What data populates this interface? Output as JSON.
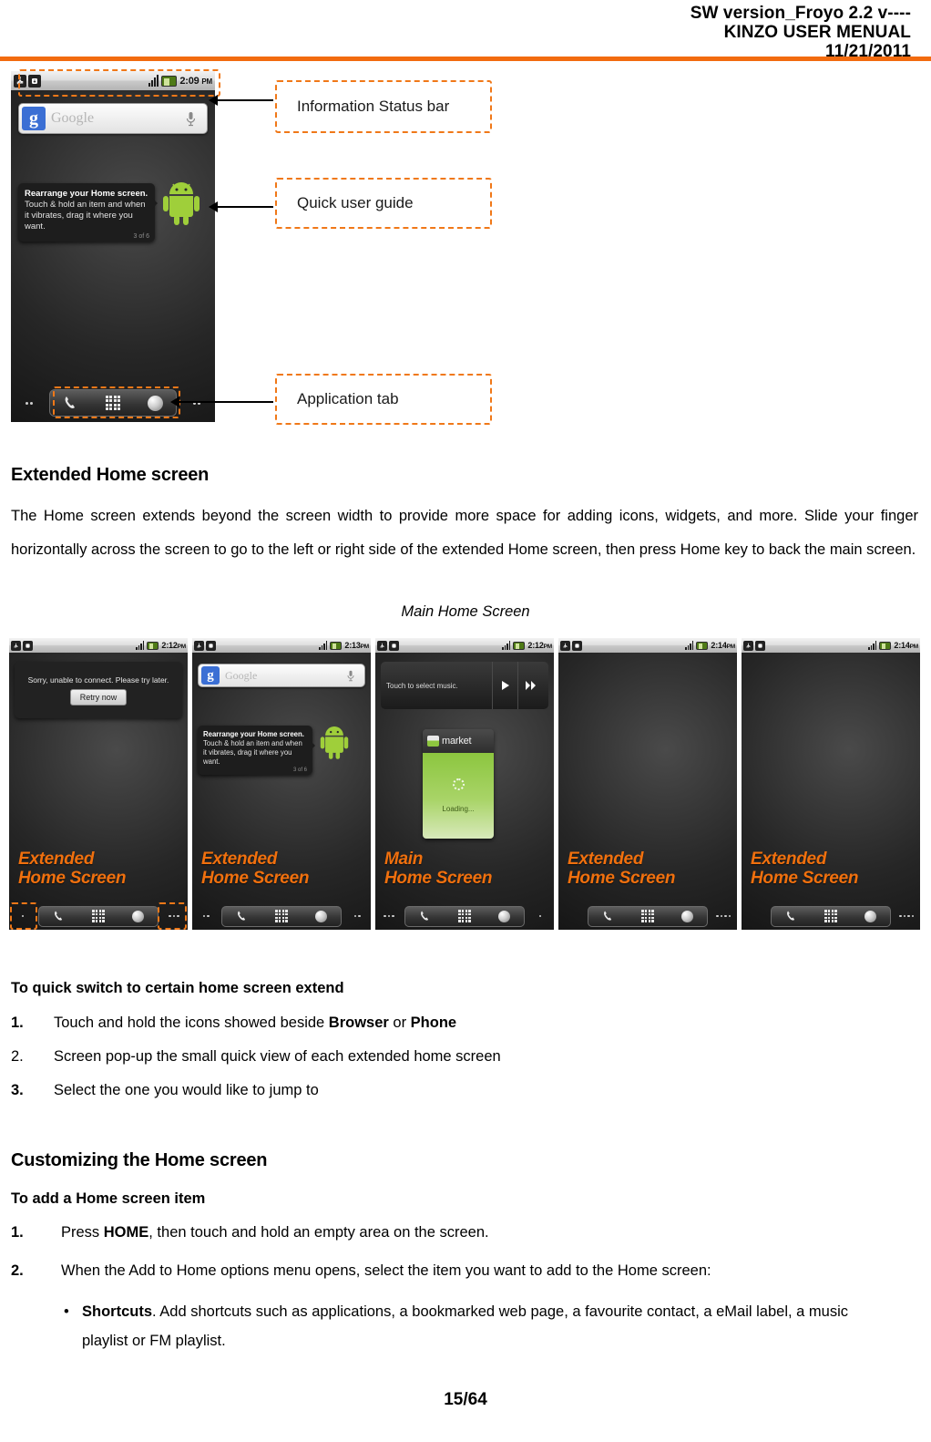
{
  "header": {
    "line1": "SW version_Froyo 2.2 v----",
    "line2": "KINZO USER MENUAL",
    "line3": "11/21/2011",
    "rule_color": "#F26B0F"
  },
  "colors": {
    "accent_orange": "#F0700E",
    "callout_border": "#F07818"
  },
  "figure1": {
    "status_bar": {
      "usb_icon": "usb-icon",
      "download_icon": "android-download-icon",
      "signal_icon": "signal-bars-icon",
      "battery_icon": "battery-icon",
      "time": "2:09",
      "ampm": "PM"
    },
    "search_widget": {
      "logo": "google-g-logo",
      "placeholder": "Google",
      "mic_icon": "microphone-icon"
    },
    "tip": {
      "title": "Rearrange your Home screen.",
      "body": "Touch & hold an item and when it vibrates, drag it where you want.",
      "counter": "3 of 6"
    },
    "mascot": "android-mascot-icon",
    "dock": {
      "phone_icon": "phone-icon",
      "apps_icon": "all-apps-grid-icon",
      "browser_icon": "browser-globe-icon",
      "left_dots": 2,
      "right_dots": 2
    }
  },
  "callouts": [
    {
      "label": "Information Status bar"
    },
    {
      "label": "Quick user guide"
    },
    {
      "label": "Application tab"
    }
  ],
  "section1": {
    "heading": "Extended Home screen",
    "paragraph": "The Home screen extends beyond the screen width to provide more space for adding icons, widgets, and more.  Slide your finger horizontally across the screen to go to the left or right side of the extended Home screen, then press Home key to back the main screen.",
    "caption": "Main Home Screen"
  },
  "figure2": {
    "screens": [
      {
        "time": "2:12",
        "ampm": "PM",
        "label_line1": "Extended",
        "label_line2": "Home Screen",
        "content": "toast",
        "toast_text": "Sorry, unable to connect. Please try later.",
        "toast_button": "Retry now",
        "left_dots": 1,
        "right_dots": 3,
        "highlight_dots": true
      },
      {
        "time": "2:13",
        "ampm": "PM",
        "label_line1": "Extended",
        "label_line2": "Home Screen",
        "content": "search-and-tip",
        "search_placeholder": "Google",
        "tip_title": "Rearrange your Home screen.",
        "tip_body": "Touch & hold an item and when it vibrates, drag it where you want.",
        "tip_counter": "3 of 6",
        "left_dots": 2,
        "right_dots": 2,
        "highlight_dots": false
      },
      {
        "time": "2:12",
        "ampm": "PM",
        "label_line1": "Main",
        "label_line2": "Home Screen",
        "content": "music-and-market",
        "music_text": "Touch to select music.",
        "market_title": "market",
        "market_loading": "Loading...",
        "left_dots": 3,
        "right_dots": 1,
        "highlight_dots": false
      },
      {
        "time": "2:14",
        "ampm": "PM",
        "label_line1": "Extended",
        "label_line2": "Home Screen",
        "content": "empty",
        "left_dots": 0,
        "right_dots": 4,
        "highlight_dots": false
      },
      {
        "time": "2:14",
        "ampm": "PM",
        "label_line1": "Extended",
        "label_line2": "Home Screen",
        "content": "empty",
        "left_dots": 0,
        "right_dots": 4,
        "highlight_dots": false
      }
    ]
  },
  "section2": {
    "subhead": "To quick switch to certain home screen extend",
    "items": [
      {
        "num": "1.",
        "pre": "Touch and hold the icons showed beside ",
        "b1": "Browser",
        "mid": " or ",
        "b2": "Phone",
        "post": ""
      },
      {
        "num": "2.",
        "pre": "Screen pop-up the small quick view of each extended home screen",
        "b1": "",
        "mid": "",
        "b2": "",
        "post": ""
      },
      {
        "num": "3.",
        "pre": "Select the one you would like to jump to",
        "b1": "",
        "mid": "",
        "b2": "",
        "post": ""
      }
    ]
  },
  "section3": {
    "heading": "Customizing the Home screen",
    "subhead": "To add a Home screen item",
    "item1": {
      "num": "1.",
      "pre": "Press ",
      "bold": "HOME",
      "post": ", then touch and hold an empty area on the screen."
    },
    "item2": {
      "num": "2.",
      "text": "When the Add to Home options menu opens, select the item you want to add to the Home screen:"
    },
    "bullet": {
      "dot": "•",
      "bold": "Shortcuts",
      "text": ". Add shortcuts such as applications, a bookmarked web page, a favourite contact, a eMail label,  a music playlist or FM playlist."
    }
  },
  "footer": {
    "page": "15/64"
  }
}
